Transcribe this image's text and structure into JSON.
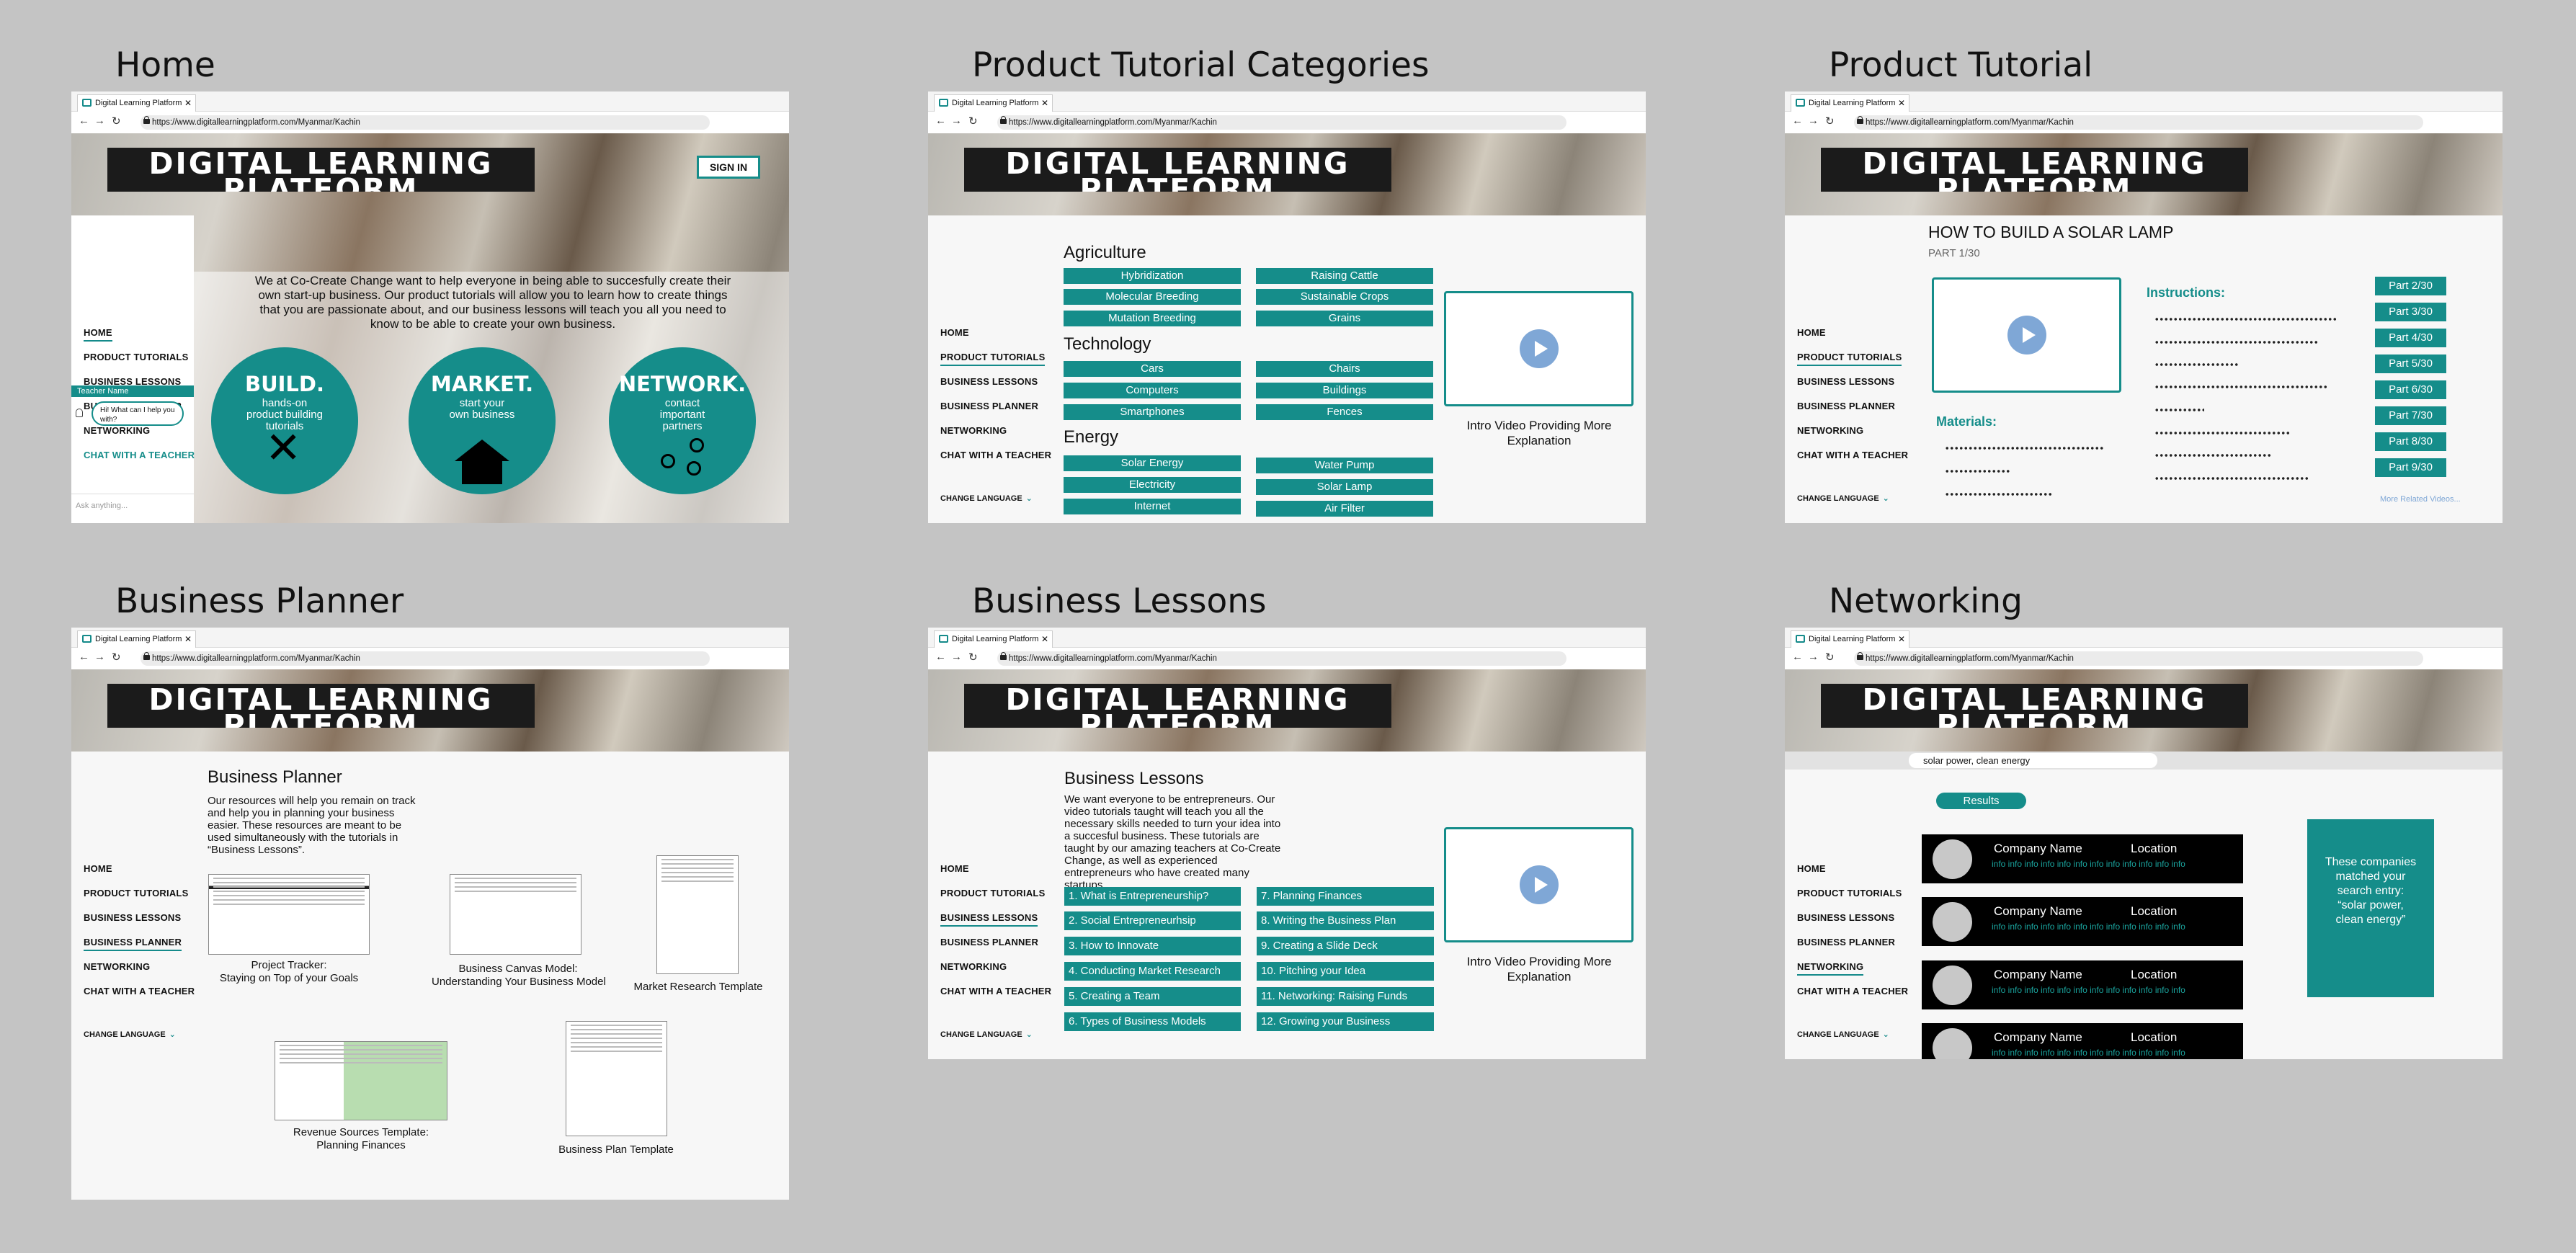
{
  "browser": {
    "tab": "Digital Learning Platform",
    "url": "https://www.digitallearningplatform.com/Myanmar/Kachin"
  },
  "logo": {
    "line1": "DIGITAL LEARNING",
    "line2": "PLATFORM"
  },
  "nav": [
    "HOME",
    "PRODUCT TUTORIALS",
    "BUSINESS LESSONS",
    "BUSINESS PLANNER",
    "NETWORKING",
    "CHAT WITH A TEACHER"
  ],
  "change_language": "CHANGE LANGUAGE",
  "screens": [
    {
      "title": "Home",
      "sign_in": "SIGN IN",
      "intro": "We at Co-Create Change want to help everyone in being able to succesfully create their own start-up business. Our product tutorials will allow you to learn how to create things that you are passionate about, and our business lessons will teach you all you need to know to be able to create your own business.",
      "chat": {
        "teacher": "Teacher Name",
        "message": "Hi! What can I help you with?",
        "input": "Ask anything..."
      },
      "cards": [
        {
          "title": "BUILD.",
          "sub": "hands-on product building tutorials",
          "icon": "tools-icon"
        },
        {
          "title": "MARKET.",
          "sub": "start your own business",
          "icon": "house-chart-icon"
        },
        {
          "title": "NETWORK.",
          "sub": "contact important partners",
          "icon": "network-icon"
        }
      ]
    },
    {
      "title": "Product Tutorial Categories",
      "sections": [
        {
          "name": "Agriculture",
          "left": [
            "Hybridization",
            "Molecular Breeding",
            "Mutation Breeding"
          ],
          "right": [
            "Raising Cattle",
            "Sustainable Crops",
            "Grains"
          ]
        },
        {
          "name": "Technology",
          "left": [
            "Cars",
            "Computers",
            "Smartphones"
          ],
          "right": [
            "Chairs",
            "Buildings",
            "Fences"
          ]
        },
        {
          "name": "Energy",
          "left": [
            "Solar Energy",
            "Electricity",
            "Internet"
          ],
          "right": [
            "Water Pump",
            "Solar Lamp",
            "Air Filter"
          ]
        }
      ],
      "video_caption": "Intro Video Providing More Explanation"
    },
    {
      "title": "Product Tutorial",
      "heading": "HOW TO BUILD A SOLAR LAMP",
      "part": "PART 1/30",
      "instructions": "Instructions:",
      "materials": "Materials:",
      "parts": [
        "Part 2/30",
        "Part 3/30",
        "Part 4/30",
        "Part 5/30",
        "Part 6/30",
        "Part 7/30",
        "Part 8/30",
        "Part 9/30"
      ],
      "more": "More Related Videos..."
    },
    {
      "title": "Business Planner",
      "heading": "Business Planner",
      "text": "Our resources will help you remain on track and help you in planning your business easier. These resources are meant to be used simultaneously with the tutorials in “Business Lessons”.",
      "templates": [
        "Project Tracker:",
        "Staying on Top of your Goals",
        "Business Canvas Model:",
        "Understanding Your Business Model",
        "Market Research Template",
        "Revenue Sources Template:",
        "Planning Finances",
        "Business Plan Template"
      ]
    },
    {
      "title": "Business Lessons",
      "heading": "Business Lessons",
      "text": "We want everyone to be entrepreneurs. Our video tutorials taught will teach you all the necessary skills needed to turn your idea into a succesful business. These tutorials are taught by our amazing teachers at Co-Create Change, as well as experienced entrepreneurs who have created many startups.",
      "lessons_left": [
        "1. What is Entrepreneurship?",
        "2. Social Entrepreneurhsip",
        "3. How to Innovate",
        "4. Conducting Market Research",
        "5. Creating a Team",
        "6. Types of Business Models"
      ],
      "lessons_right": [
        "7. Planning Finances",
        "8. Writing the Business Plan",
        "9. Creating a Slide Deck",
        "10. Pitching your Idea",
        "11. Networking: Raising Funds",
        "12. Growing your Business"
      ],
      "video_caption": "Intro Video Providing More Explanation"
    },
    {
      "title": "Networking",
      "search": "solar power, clean energy",
      "results": "Results",
      "company": "Company Name",
      "location": "Location",
      "info": "info info info info info info info info info info info info",
      "match": "These companies matched your search entry: “solar power, clean energy”"
    }
  ],
  "colors": {
    "teal": "#158d8a",
    "background": "#c4c4c4"
  }
}
